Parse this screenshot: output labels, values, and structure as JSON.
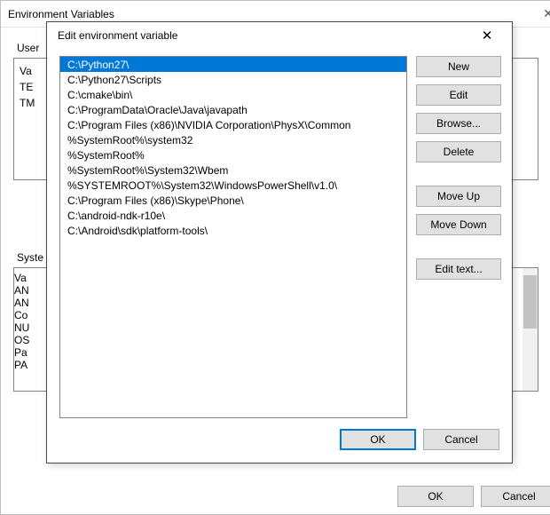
{
  "bg": {
    "title": "Environment Variables",
    "userLabel": "User",
    "sysLabel": "Syste",
    "userVars": [
      "Va",
      "TE",
      "TM"
    ],
    "sysVars": [
      "Va",
      "AN",
      "AN",
      "Co",
      "NU",
      "OS",
      "Pa",
      "PA"
    ],
    "ok": "OK",
    "cancel": "Cancel"
  },
  "fg": {
    "title": "Edit environment variable",
    "entries": [
      "C:\\Python27\\",
      "C:\\Python27\\Scripts",
      "C:\\cmake\\bin\\",
      "C:\\ProgramData\\Oracle\\Java\\javapath",
      "C:\\Program Files (x86)\\NVIDIA Corporation\\PhysX\\Common",
      "%SystemRoot%\\system32",
      "%SystemRoot%",
      "%SystemRoot%\\System32\\Wbem",
      "%SYSTEMROOT%\\System32\\WindowsPowerShell\\v1.0\\",
      "C:\\Program Files (x86)\\Skype\\Phone\\",
      "C:\\android-ndk-r10e\\",
      "C:\\Android\\sdk\\platform-tools\\"
    ],
    "selectedIndex": 0,
    "buttons": {
      "new": "New",
      "edit": "Edit",
      "browse": "Browse...",
      "delete": "Delete",
      "moveUp": "Move Up",
      "moveDown": "Move Down",
      "editText": "Edit text...",
      "ok": "OK",
      "cancel": "Cancel"
    }
  }
}
